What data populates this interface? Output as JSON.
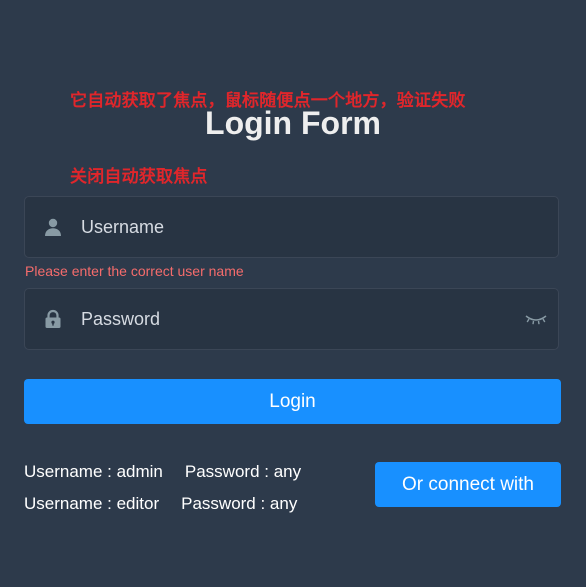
{
  "annotations": {
    "focus_note": "它自动获取了焦点，鼠标随便点一个地方，验证失败",
    "disable_note": "关闭自动获取焦点"
  },
  "form": {
    "title": "Login Form",
    "username_placeholder": "Username",
    "username_value": "",
    "username_error": "Please enter the correct user name",
    "password_placeholder": "Password",
    "password_value": "",
    "login_label": "Login"
  },
  "tips": [
    {
      "username": "Username : admin",
      "password": "Password : any"
    },
    {
      "username": "Username : editor",
      "password": "Password : any"
    }
  ],
  "connect_label": "Or connect with",
  "colors": {
    "background": "#2d3a4b",
    "input_background": "#283443",
    "accent": "#1890ff",
    "error": "#f56c6c",
    "annotation": "#e0262b",
    "icon": "#889aa4"
  },
  "icons": {
    "username": "user-icon",
    "password": "lock-icon",
    "show_password": "eye-closed-icon"
  }
}
